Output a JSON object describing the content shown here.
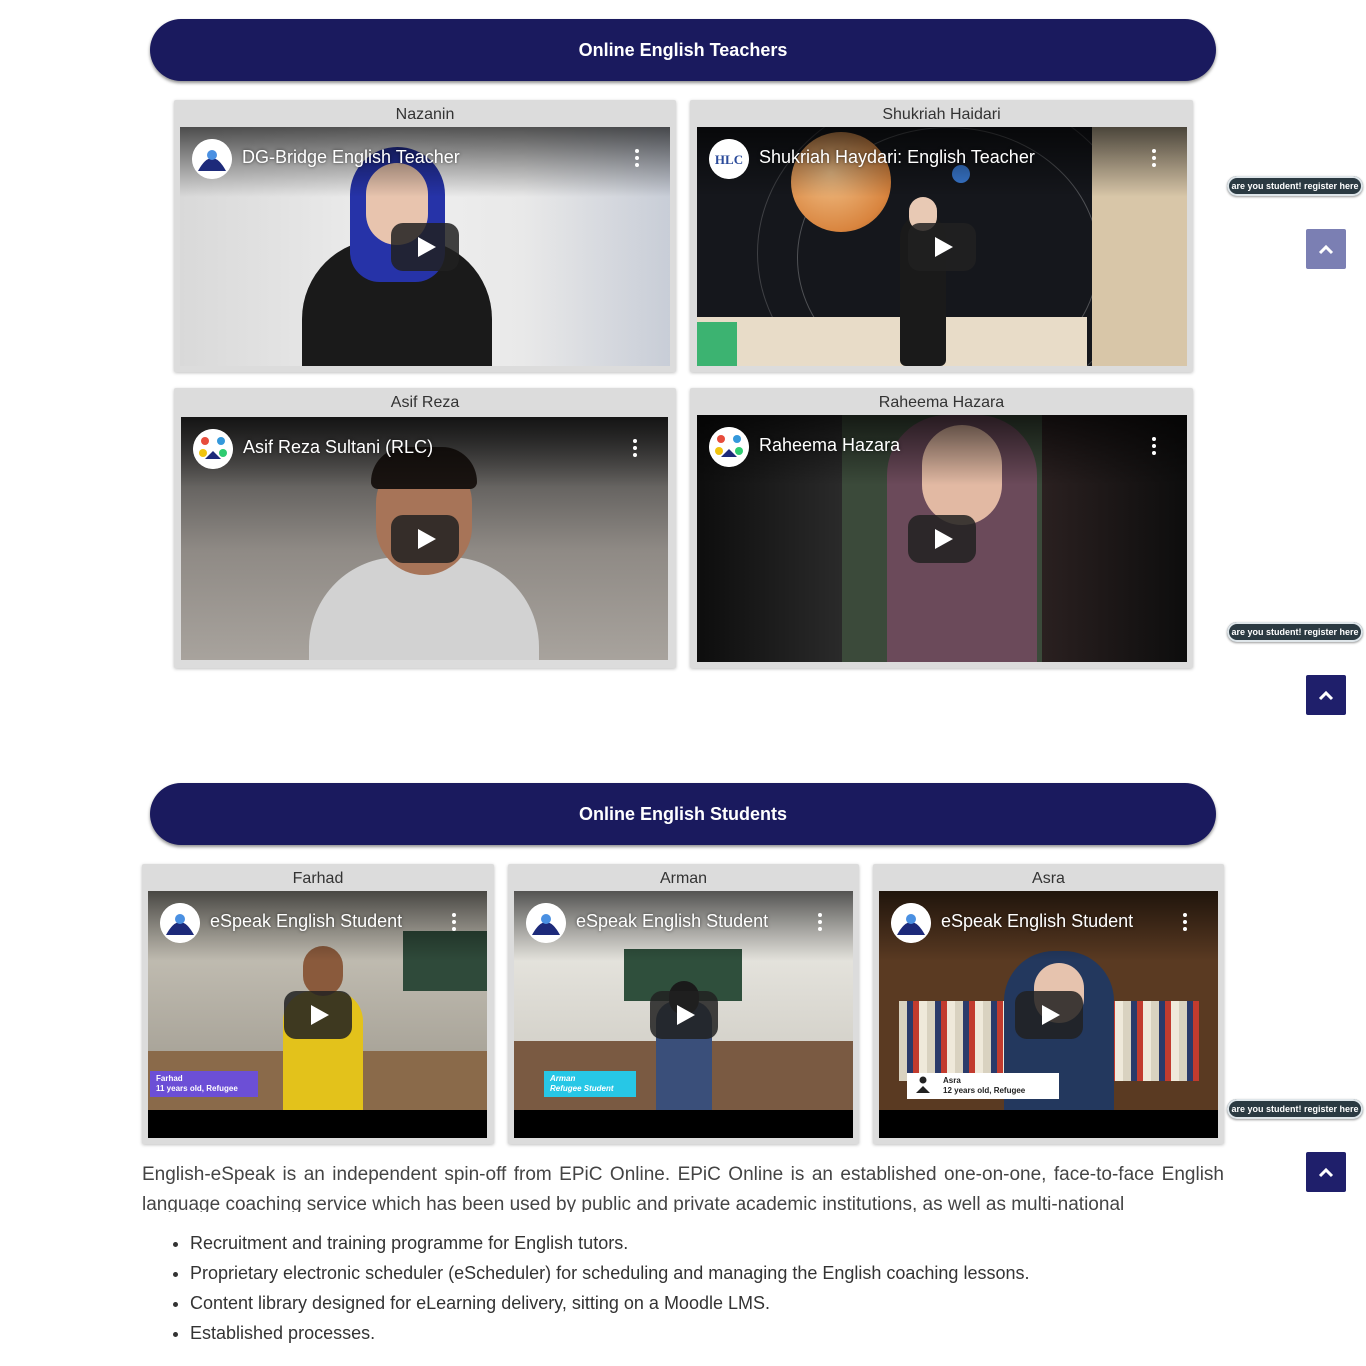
{
  "teachers_section": {
    "heading": "Online English Teachers",
    "cards": [
      {
        "name": "Nazanin",
        "video_title": "DG-Bridge English Teacher",
        "channel_icon": "dg-bridge-logo-icon"
      },
      {
        "name": "Shukriah Haidari",
        "video_title": "Shukriah Haydari: English Teacher",
        "channel_icon": "hlc-logo-icon"
      },
      {
        "name": "Asif Reza",
        "video_title": "Asif Reza Sultani (RLC)",
        "channel_icon": "rlc-logo-icon"
      },
      {
        "name": "Raheema Hazara",
        "video_title": "Raheema Hazara",
        "channel_icon": "rlc-logo-icon"
      }
    ]
  },
  "students_section": {
    "heading": "Online English Students",
    "cards": [
      {
        "name": "Farhad",
        "video_title": "eSpeak English Student",
        "caption_name": "Farhad",
        "caption_detail": "11 years old, Refugee"
      },
      {
        "name": "Arman",
        "video_title": "eSpeak English Student",
        "caption_name": "Arman",
        "caption_detail": "Refugee Student"
      },
      {
        "name": "Asra",
        "video_title": "eSpeak English Student",
        "caption_name": "Asra",
        "caption_detail": "12 years old, Refugee"
      }
    ]
  },
  "side_widgets": {
    "register_label": "are you student! register here",
    "scroll_top_icon": "chevron-up-icon"
  },
  "about": {
    "description": "English-eSpeak is an independent spin-off from EPiC Online. EPiC Online is an established one-on-one, face-to-face English language coaching service which has been used by public and private academic institutions, as well as multi-national",
    "features": [
      "Recruitment and training programme for English tutors.",
      "Proprietary electronic scheduler (eScheduler) for scheduling and managing the English coaching lessons.",
      "Content library designed for eLearning delivery, sitting on a Moodle LMS.",
      "Established processes."
    ]
  },
  "colors": {
    "banner_bg": "#1a1a5e",
    "card_bg": "#dcdcdc",
    "scroll_button_active": "#1f1f6b",
    "scroll_button_faded": "#7b7fb3",
    "register_pill": "#2b3a42"
  }
}
